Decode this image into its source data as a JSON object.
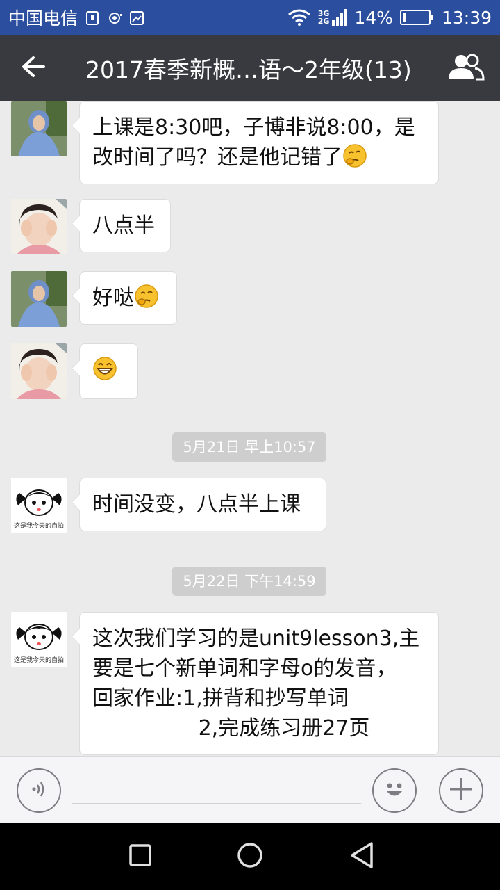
{
  "status_bar": {
    "carrier": "中国电信",
    "net_top": "3G",
    "net_bottom": "2G",
    "battery": "14%",
    "battery_fraction": 0.14,
    "time": "13:39"
  },
  "header": {
    "title": "2017春季新概…语～2年级(13)",
    "back_icon": "arrow-left-icon",
    "members_icon": "group-members-icon"
  },
  "messages": [
    {
      "sender_avatar": "girl-blue-scarf-avatar",
      "text": "上课是8:30吧，子博非说8:00，是\n改时间了吗？还是他记错了",
      "emoji": "thinking-emoji"
    },
    {
      "sender_avatar": "child-hands-face-avatar",
      "text": "八点半"
    },
    {
      "sender_avatar": "girl-blue-scarf-avatar",
      "text": "好哒",
      "emoji": "thinking-emoji"
    },
    {
      "sender_avatar": "child-hands-face-avatar",
      "text": "",
      "emoji": "grinning-emoji"
    },
    {
      "timestamp": "5月21日 早上10:57"
    },
    {
      "sender_avatar": "cartoon-selfie-avatar",
      "avatar_caption": "这是我今天的自拍",
      "text": "时间没变，八点半上课"
    },
    {
      "timestamp": "5月22日 下午14:59"
    },
    {
      "sender_avatar": "cartoon-selfie-avatar",
      "avatar_caption": "这是我今天的自拍",
      "text": "这次我们学习的是unit9lesson3,主\n要是七个新单词和字母o的发音，\n回家作业:1,拼背和抄写单词\n                2,完成练习册27页"
    }
  ],
  "input_bar": {
    "voice_icon": "voice-icon",
    "emoji_icon": "smiley-icon",
    "more_icon": "plus-icon",
    "input_value": ""
  },
  "nav_bar": {
    "recents_icon": "square-icon",
    "home_icon": "circle-icon",
    "back_icon": "triangle-back-icon"
  },
  "colors": {
    "status_bar": "#2b4f9e",
    "title_bar": "#393a3f",
    "chat_background": "#ebebeb",
    "bubble": "#ffffff",
    "timestamp_bg": "#cecece"
  }
}
